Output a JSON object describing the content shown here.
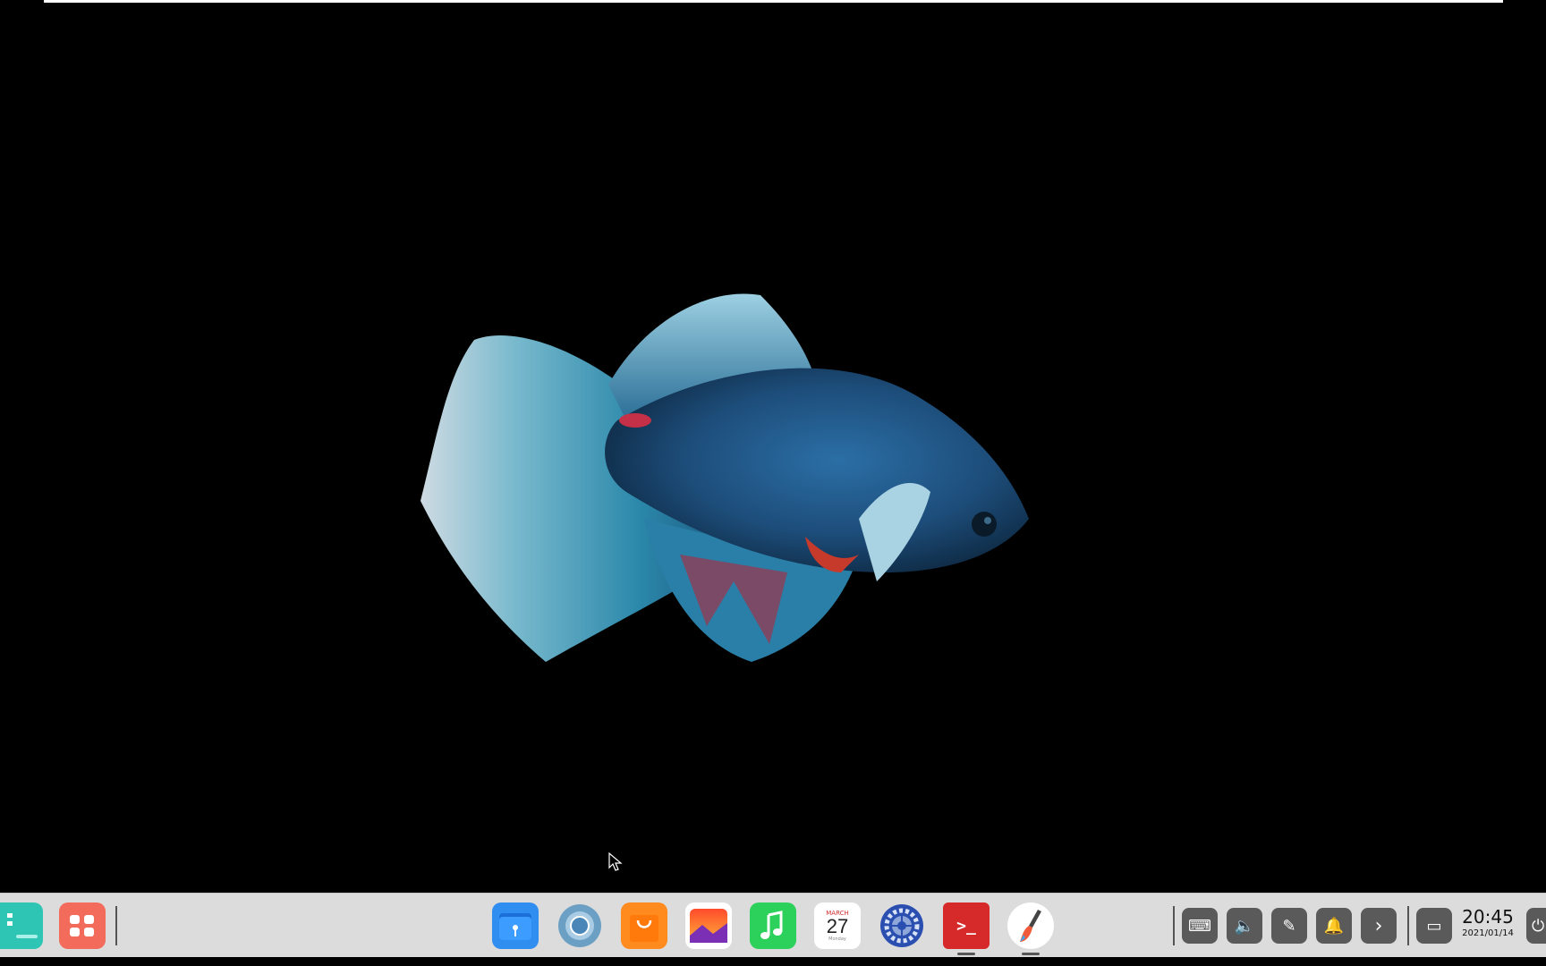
{
  "desktop": {
    "wallpaper_icon": "betta-fish-wallpaper"
  },
  "taskbar": {
    "left_items": [
      {
        "name": "show-desktop",
        "icon": "desktop-icon"
      },
      {
        "name": "launcher",
        "icon": "grid-icon"
      }
    ],
    "apps": [
      {
        "name": "file-manager",
        "icon": "folder-icon"
      },
      {
        "name": "browser",
        "icon": "browser-icon"
      },
      {
        "name": "app-store",
        "icon": "bag-icon"
      },
      {
        "name": "image-viewer",
        "icon": "photo-icon"
      },
      {
        "name": "music",
        "icon": "music-note-icon"
      },
      {
        "name": "calendar",
        "icon": "calendar-icon"
      },
      {
        "name": "control-center",
        "icon": "settings-icon"
      },
      {
        "name": "terminal",
        "icon": "terminal-icon"
      },
      {
        "name": "draw",
        "icon": "brush-icon"
      }
    ],
    "calendar": {
      "month": "MARCH",
      "day": "27",
      "weekday": "Monday"
    },
    "terminal_prompt": ">_",
    "tray": [
      {
        "name": "keyboard",
        "icon": "keyboard-icon",
        "glyph": "⌨"
      },
      {
        "name": "volume",
        "icon": "volume-icon",
        "glyph": "🔈"
      },
      {
        "name": "pen",
        "icon": "pen-icon",
        "glyph": "✎"
      },
      {
        "name": "notifications",
        "icon": "bell-icon",
        "glyph": "🔔"
      },
      {
        "name": "expand-tray",
        "icon": "chevron-right-icon",
        "glyph": "›"
      },
      {
        "name": "multitask",
        "icon": "window-icon",
        "glyph": "▭"
      }
    ],
    "clock": {
      "time": "20:45",
      "date": "2021/01/14"
    },
    "power_glyph": "⏻"
  },
  "colors": {
    "desktop_bg": "#000000",
    "taskbar_bg": "#dcdcdc",
    "tray_btn": "#5a5a5a"
  }
}
